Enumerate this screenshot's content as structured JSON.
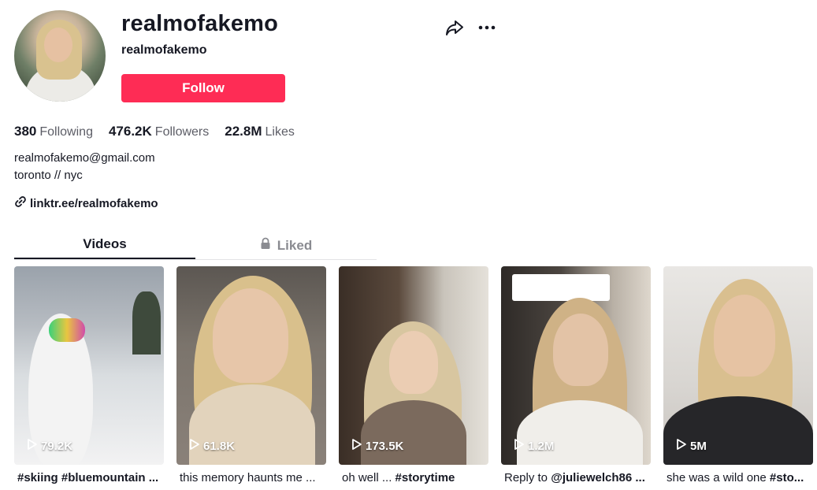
{
  "profile": {
    "username": "realmofakemo",
    "nickname": "realmofakemo",
    "follow_label": "Follow"
  },
  "stats": [
    {
      "value": "380",
      "label": "Following"
    },
    {
      "value": "476.2K",
      "label": "Followers"
    },
    {
      "value": "22.8M",
      "label": "Likes"
    }
  ],
  "bio": {
    "line1": "realmofakemo@gmail.com",
    "line2": "toronto // nyc",
    "link": "linktr.ee/realmofakemo"
  },
  "tabs": {
    "videos": "Videos",
    "liked": "Liked"
  },
  "videos": [
    {
      "views": "79.2K",
      "caption": "#skiing #bluemountain ..."
    },
    {
      "views": "61.8K",
      "caption": "this memory haunts me ..."
    },
    {
      "views": "173.5K",
      "caption_plain": "oh well ... ",
      "caption_bold": "#storytime"
    },
    {
      "views": "1.2M",
      "caption_plain": "Reply to ",
      "caption_bold": "@juliewelch86 ..."
    },
    {
      "views": "5M",
      "caption_plain": "she was a wild one ",
      "caption_bold": "#sto..."
    }
  ],
  "colors": {
    "accent": "#fe2c55",
    "text": "#161823",
    "muted": "#5c5d66"
  },
  "icons": [
    "share-icon",
    "more-icon",
    "link-icon",
    "lock-icon",
    "play-icon"
  ]
}
